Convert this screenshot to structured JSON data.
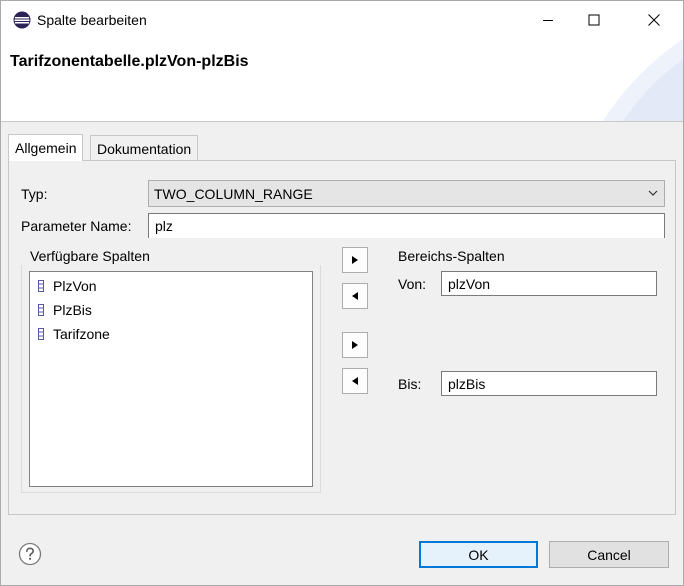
{
  "window": {
    "title": "Spalte bearbeiten",
    "icon": "eclipse-icon"
  },
  "header": {
    "title": "Tarifzonentabelle.plzVon-plzBis"
  },
  "tabs": [
    {
      "label": "Allgemein",
      "active": true
    },
    {
      "label": "Dokumentation",
      "active": false
    }
  ],
  "form": {
    "type_label": "Typ:",
    "type_value": "TWO_COLUMN_RANGE",
    "param_label": "Parameter Name:",
    "param_value": "plz"
  },
  "available": {
    "label": "Verfügbare Spalten",
    "items": [
      "PlzVon",
      "PlzBis",
      "Tarifzone"
    ]
  },
  "range": {
    "label": "Bereichs-Spalten",
    "von_label": "Von:",
    "von_value": "plzVon",
    "bis_label": "Bis:",
    "bis_value": "plzBis"
  },
  "footer": {
    "ok_label": "OK",
    "cancel_label": "Cancel"
  },
  "colors": {
    "accent": "#0078d7",
    "ok_bg": "#e5f1fb",
    "column_icon": "#5a5aa0"
  }
}
